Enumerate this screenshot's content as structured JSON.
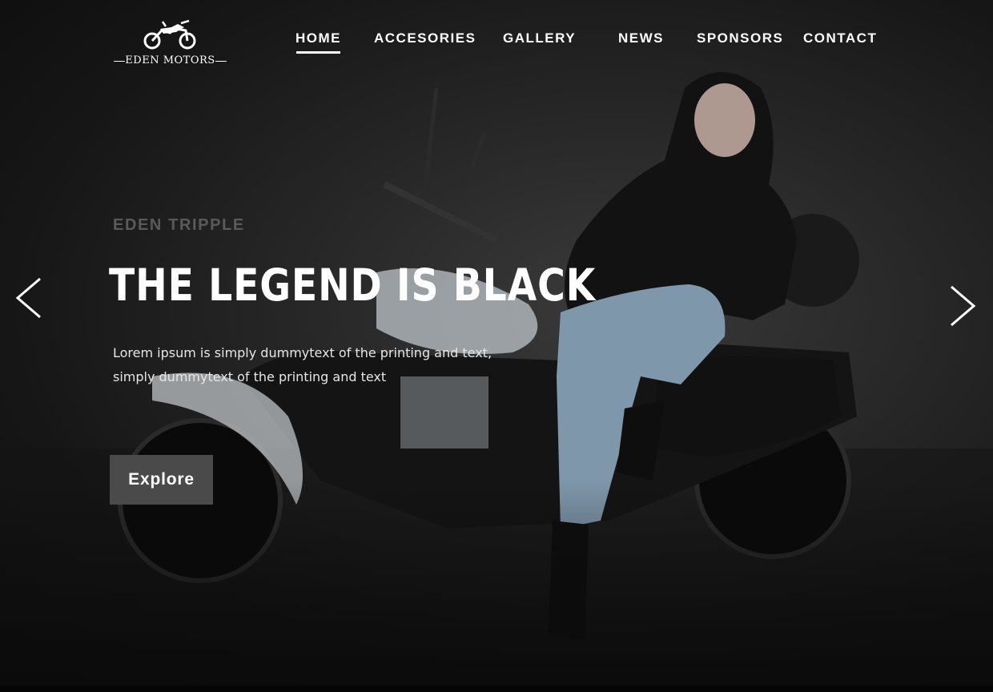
{
  "brand": {
    "name": "EDEN MOTORS",
    "logo_icon": "motorbike-icon"
  },
  "nav": {
    "items": [
      {
        "label": "HOME",
        "active": true
      },
      {
        "label": "ACCESORIES",
        "active": false
      },
      {
        "label": "GALLERY",
        "active": false
      },
      {
        "label": "NEWS",
        "active": false
      },
      {
        "label": "SPONSORS",
        "active": false
      },
      {
        "label": "CONTACT",
        "active": false
      }
    ]
  },
  "hero": {
    "eyebrow": "EDEN TRIPPLE",
    "headline": "THE LEGEND IS BLACK",
    "description_line1": "Lorem ipsum is simply dummytext of the printing and text,",
    "description_line2": "simply dummytext of the printing and text",
    "cta_label": "Explore",
    "prev_icon": "chevron-left-icon",
    "next_icon": "chevron-right-icon",
    "background": "rider-on-motorcycle-photo"
  },
  "colors": {
    "background": "#1e1e1e",
    "text": "#ffffff",
    "eyebrow": "#5a5a5a",
    "button": "#4a4a4a"
  }
}
